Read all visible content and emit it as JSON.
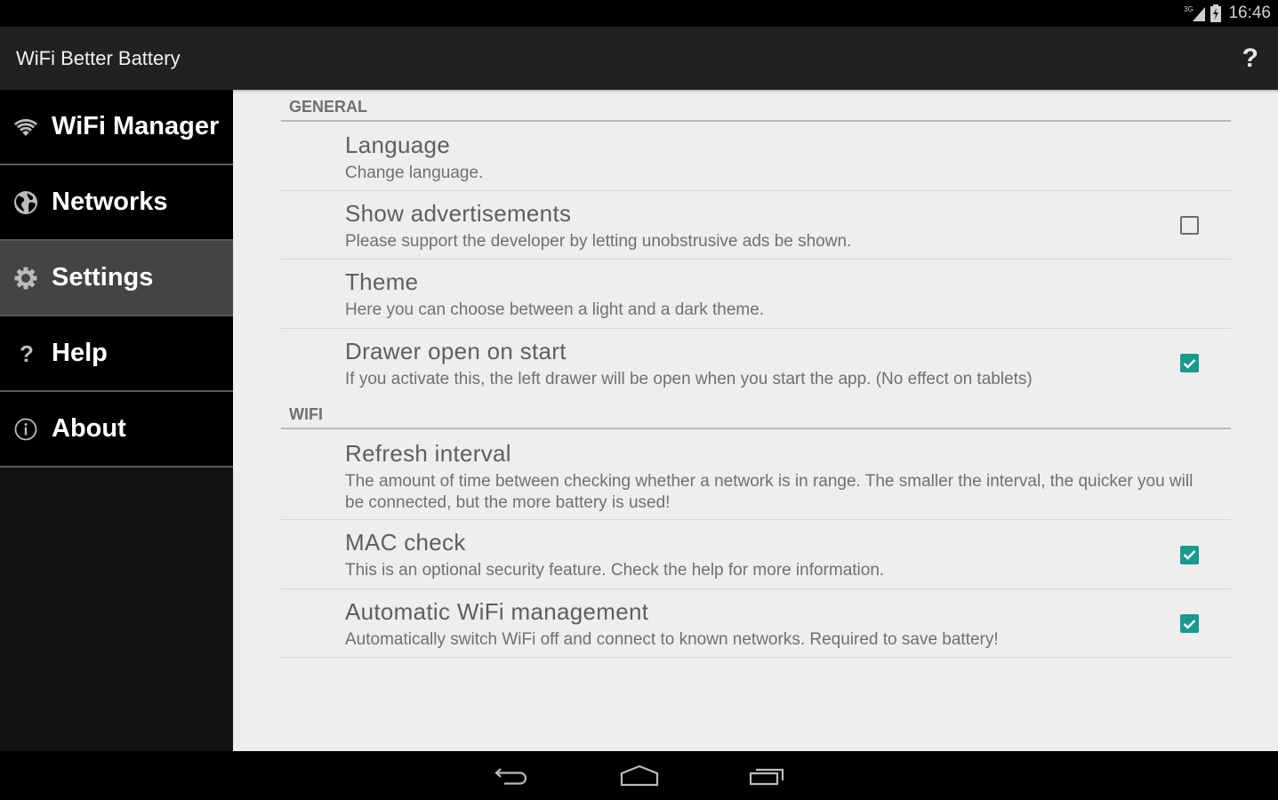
{
  "status_bar": {
    "network_label": "3G",
    "signal_icon": "signal-icon",
    "battery_icon": "battery-charging-icon",
    "time": "16:46"
  },
  "action_bar": {
    "title": "WiFi Better Battery",
    "help_label": "?"
  },
  "drawer": {
    "items": [
      {
        "label": "WiFi Manager",
        "icon": "wifi-icon",
        "active": false
      },
      {
        "label": "Networks",
        "icon": "globe-icon",
        "active": false
      },
      {
        "label": "Settings",
        "icon": "gear-icon",
        "active": true
      },
      {
        "label": "Help",
        "icon": "question-icon",
        "active": false
      },
      {
        "label": "About",
        "icon": "info-icon",
        "active": false
      }
    ]
  },
  "settings": {
    "categories": [
      {
        "title": "GENERAL",
        "items": [
          {
            "title": "Language",
            "summary": "Change language.",
            "checkbox": null
          },
          {
            "title": "Show advertisements",
            "summary": "Please support the developer by letting unobstrusive ads be shown.",
            "checkbox": false
          },
          {
            "title": "Theme",
            "summary": "Here you can choose between a light and a dark theme.",
            "checkbox": null
          },
          {
            "title": "Drawer open on start",
            "summary": "If you activate this, the left drawer will be open when you start the app. (No effect on tablets)",
            "checkbox": true
          }
        ]
      },
      {
        "title": "WIFI",
        "items": [
          {
            "title": "Refresh interval",
            "summary": "The amount of time between checking whether a network is in range. The smaller the interval, the quicker you will be connected, but the more battery is used!",
            "checkbox": null
          },
          {
            "title": "MAC check",
            "summary": "This is an optional security feature. Check the help for more information.",
            "checkbox": true
          },
          {
            "title": "Automatic WiFi management",
            "summary": "Automatically switch WiFi off and connect to known networks. Required to save battery!",
            "checkbox": true
          }
        ]
      }
    ]
  },
  "nav_bar": {
    "buttons": [
      "back-icon",
      "home-icon",
      "recents-icon"
    ]
  },
  "colors": {
    "accent": "#199a8e",
    "action_bar": "#212121",
    "drawer_active": "#444444",
    "content_bg": "#eeeeee"
  }
}
